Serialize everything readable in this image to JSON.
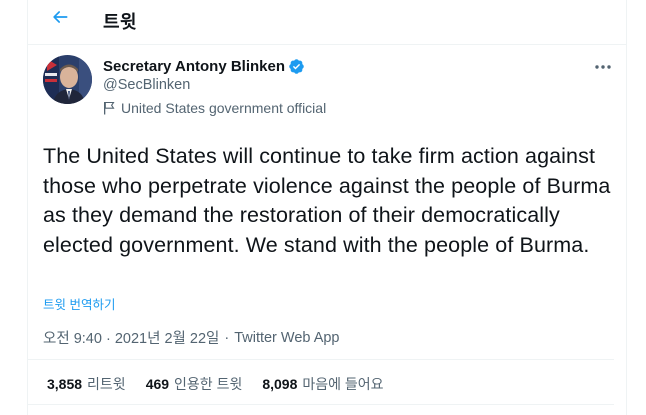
{
  "header": {
    "title": "트윗"
  },
  "author": {
    "name": "Secretary Antony Blinken",
    "handle": "@SecBlinken",
    "label": "United States government official",
    "verified": true
  },
  "tweet": {
    "text": "The United States will continue to take firm action against those who perpetrate violence against the people of Burma as they demand the restoration of their democratically elected government. We stand with the people of Burma.",
    "translate_label": "트윗 번역하기",
    "time": "오전 9:40 · 2021년 2월 22일",
    "separator": "·",
    "source": "Twitter Web App"
  },
  "stats": {
    "retweets": {
      "count": "3,858",
      "label": "리트윗"
    },
    "quotes": {
      "count": "469",
      "label": "인용한 트윗"
    },
    "likes": {
      "count": "8,098",
      "label": "마음에 들어요"
    }
  },
  "colors": {
    "accent": "#1d9bf0",
    "text_primary": "#0f1419",
    "text_secondary": "#536471",
    "border": "#eff3f4"
  },
  "icons": {
    "back": "arrow-left-icon",
    "verified": "verified-badge-icon",
    "label": "flag-icon",
    "more": "more-horizontal-icon"
  }
}
